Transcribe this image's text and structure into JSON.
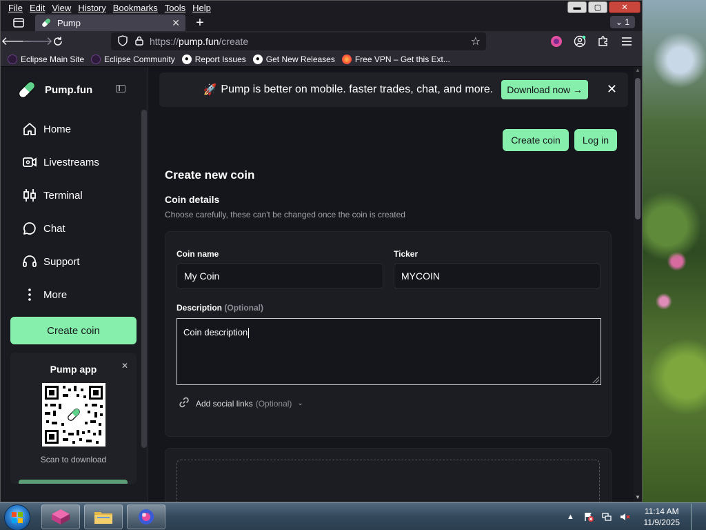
{
  "menubar": {
    "items": [
      "File",
      "Edit",
      "View",
      "History",
      "Bookmarks",
      "Tools",
      "Help"
    ]
  },
  "window_controls": {
    "minimize": "▬",
    "maximize": "▢",
    "close": "✕"
  },
  "tabbar": {
    "tab_title": "Pump",
    "tab_close": "✕",
    "new_tab": "+",
    "overflow_count": "1",
    "overflow_icon": "chevron-down-icon"
  },
  "navbar": {
    "url_scheme": "https://",
    "url_host": "pump.fun",
    "url_path": "/create"
  },
  "bookmarks": [
    {
      "label": "Eclipse Main Site",
      "icon": "eclipse-icon"
    },
    {
      "label": "Eclipse Community",
      "icon": "eclipse-icon"
    },
    {
      "label": "Report Issues",
      "icon": "github-icon"
    },
    {
      "label": "Get New Releases",
      "icon": "github-icon"
    },
    {
      "label": "Free VPN – Get this Ext...",
      "icon": "firefox-icon"
    }
  ],
  "sidebar": {
    "brand": "Pump.fun",
    "nav": [
      {
        "label": "Home",
        "icon": "home-icon"
      },
      {
        "label": "Livestreams",
        "icon": "livestream-icon"
      },
      {
        "label": "Terminal",
        "icon": "terminal-icon"
      },
      {
        "label": "Chat",
        "icon": "chat-icon"
      },
      {
        "label": "Support",
        "icon": "headset-icon"
      },
      {
        "label": "More",
        "icon": "more-icon"
      }
    ],
    "create_button": "Create coin",
    "app_card": {
      "title": "Pump app",
      "close": "✕",
      "scan_text": "Scan to download"
    }
  },
  "banner": {
    "rocket": "🚀",
    "text": "Pump is better on mobile. faster trades, chat, and more.",
    "download_button": "Download now →",
    "close": "✕"
  },
  "top_actions": {
    "create_coin": "Create coin",
    "log_in": "Log in"
  },
  "form": {
    "heading": "Create new coin",
    "section_title": "Coin details",
    "section_subtitle": "Choose carefully, these can't be changed once the coin is created",
    "coin_name_label": "Coin name",
    "coin_name_value": "My Coin",
    "ticker_label": "Ticker",
    "ticker_value": "MYCOIN",
    "description_label": "Description",
    "description_optional": "(Optional)",
    "description_value": "Coin description",
    "social_links_label": "Add social links",
    "social_links_optional": "(Optional)"
  },
  "taskbar": {
    "time": "11:14 AM",
    "date": "11/9/2025"
  },
  "colors": {
    "accent_green": "#86efac",
    "page_bg": "#15161b",
    "card_bg": "#1c1d22"
  }
}
